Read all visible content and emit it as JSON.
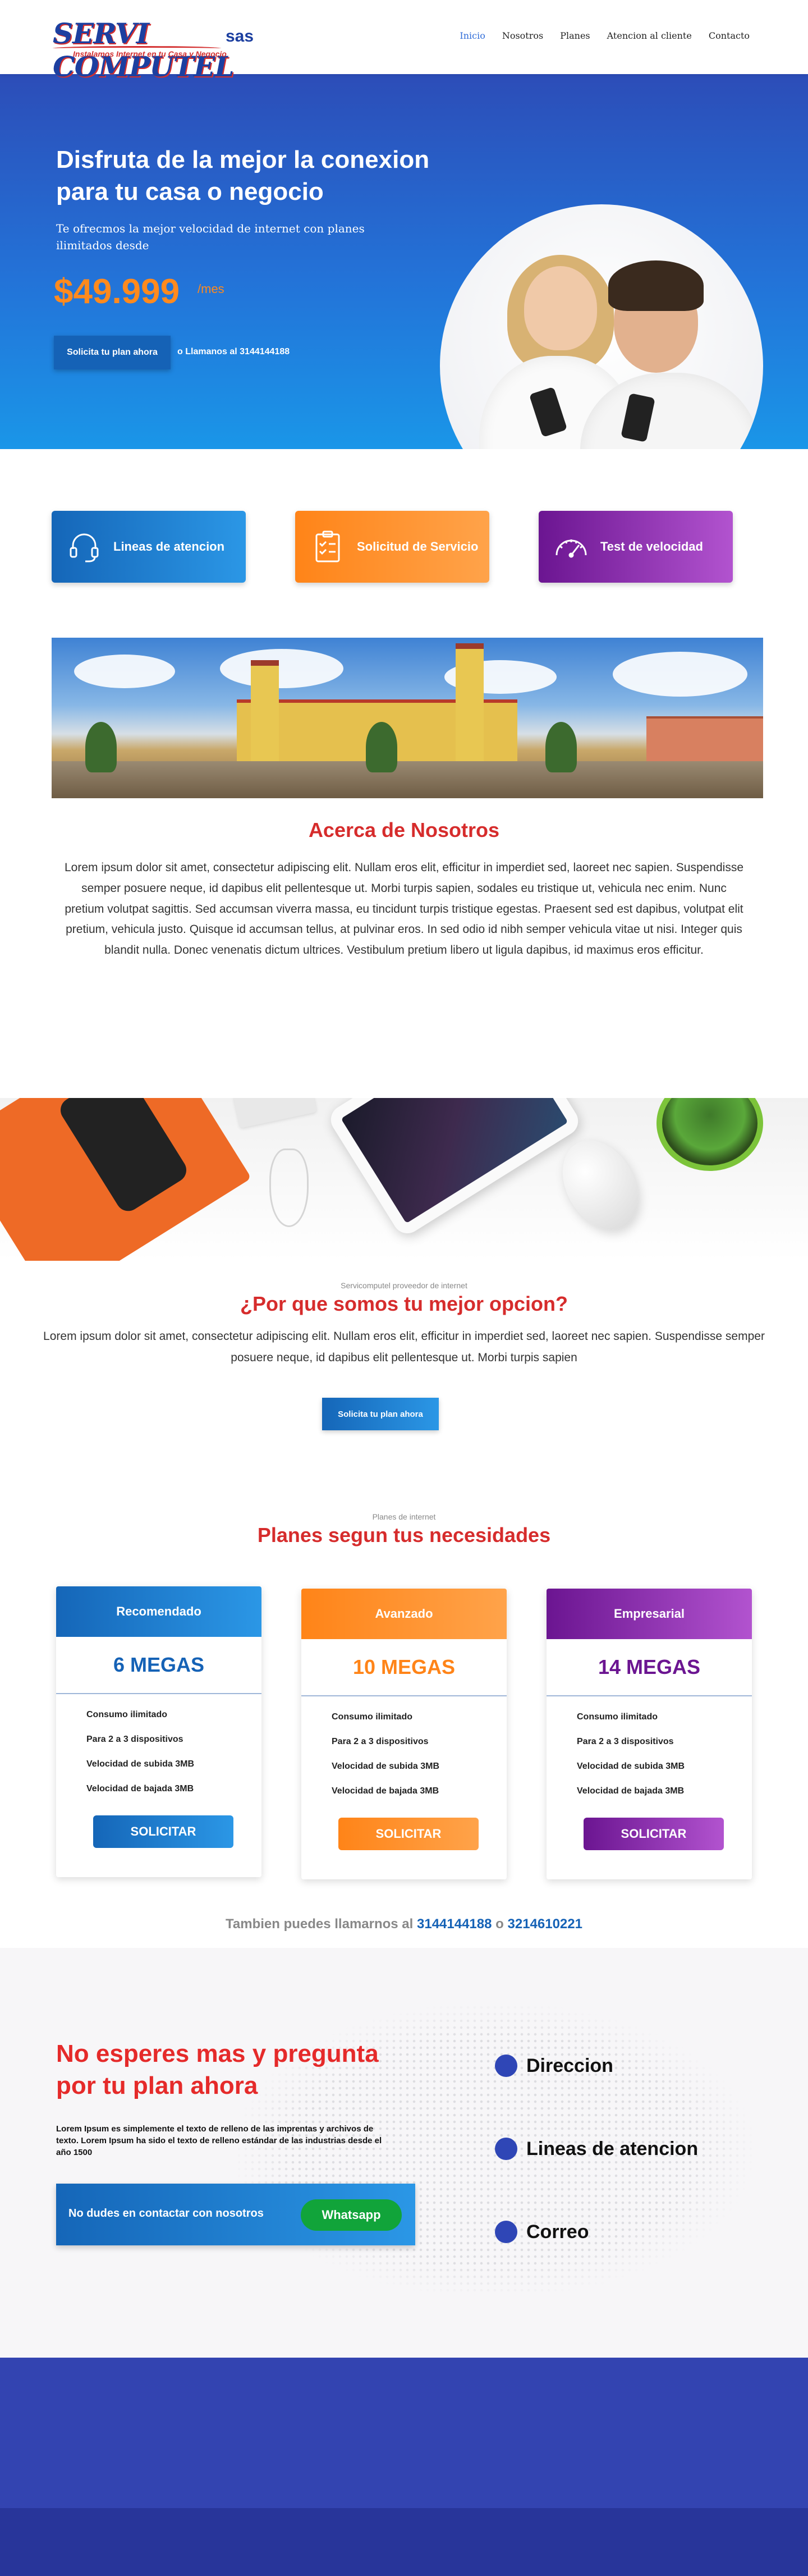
{
  "header": {
    "logo_main": "SERVI COMPUTEL",
    "logo_suffix": "sas",
    "logo_tagline": "Instalamos Internet en tu Casa y Negocio",
    "nav": [
      "Inicio",
      "Nosotros",
      "Planes",
      "Atencion al cliente",
      "Contacto"
    ],
    "active_nav": "Inicio"
  },
  "hero": {
    "title": "Disfruta de la mejor la conexion para tu casa o negocio",
    "subtitle": "Te ofrecmos la mejor velocidad de internet  con planes ilimitados desde",
    "price": "$49.999",
    "per": "/mes",
    "button": "Solicita tu plan ahora",
    "call": "o Llamanos al 3144144188"
  },
  "features": [
    {
      "label": "Lineas de atencion",
      "icon": "headset-icon"
    },
    {
      "label": "Solicitud de Servicio",
      "icon": "checklist-icon"
    },
    {
      "label": "Test de velocidad",
      "icon": "speedometer-icon"
    }
  ],
  "about": {
    "title": "Acerca de Nosotros",
    "text": "Lorem ipsum dolor sit amet, consectetur adipiscing elit. Nullam eros elit, efficitur in imperdiet sed, laoreet nec sapien. Suspendisse semper posuere neque, id dapibus elit pellentesque ut. Morbi turpis sapien, sodales eu tristique ut, vehicula nec enim. Nunc pretium volutpat sagittis. Sed accumsan viverra massa, eu tincidunt turpis tristique egestas. Praesent sed est dapibus, volutpat elit pretium, vehicula justo. Quisque id accumsan tellus, at pulvinar eros. In sed odio id nibh semper vehicula vitae ut nisi. Integer quis blandit nulla. Donec venenatis dictum ultrices. Vestibulum pretium libero ut ligula dapibus, id maximus eros efficitur."
  },
  "why": {
    "small": "Servicomputel proveedor de internet",
    "title": "¿Por que somos tu mejor opcion?",
    "text": "Lorem ipsum dolor sit amet, consectetur adipiscing elit. Nullam eros elit, efficitur in  imperdiet sed, laoreet nec sapien. Suspendisse semper posuere neque, id dapibus elit pellentesque ut. Morbi turpis sapien",
    "button": "Solicita tu plan ahora"
  },
  "plans": {
    "small": "Planes  de internet",
    "title": "Planes segun tus necesidades",
    "items": [
      {
        "name": "Recomendado",
        "speed": "6 MEGAS",
        "features": [
          "Consumo ilimitado",
          "Para 2 a 3 dispositivos",
          "Velocidad de subida 3MB",
          "Velocidad de bajada 3MB"
        ],
        "button": "SOLICITAR"
      },
      {
        "name": "Avanzado",
        "speed": "10 MEGAS",
        "features": [
          "Consumo ilimitado",
          "Para 2 a 3 dispositivos",
          "Velocidad de subida 3MB",
          "Velocidad de bajada 3MB"
        ],
        "button": "SOLICITAR"
      },
      {
        "name": "Empresarial",
        "speed": "14 MEGAS",
        "features": [
          "Consumo ilimitado",
          "Para 2 a 3 dispositivos",
          "Velocidad de subida 3MB",
          "Velocidad de bajada 3MB"
        ],
        "button": "SOLICITAR"
      }
    ]
  },
  "callus": {
    "prefix": "Tambien puedes llamarnos al",
    "phone1": "3144144188",
    "joiner": "o",
    "phone2": "3214610221"
  },
  "contact": {
    "title": "No esperes mas y pregunta por tu plan ahora",
    "text": "Lorem Ipsum es simplemente el texto de relleno de las imprentas y archivos de texto. Lorem Ipsum ha sido el texto de relleno estándar de las industrias desde el año 1500",
    "box_label": "No dudes en contactar con nosotros",
    "whatsapp": "Whatsapp",
    "items": [
      "Direccion",
      "Lineas de atencion",
      "Correo"
    ]
  },
  "colors": {
    "brand_blue": "#1562b6",
    "accent_orange": "#ff8418",
    "accent_purple": "#6b1591",
    "heading_red": "#d62c2c",
    "footer_blue": "#3344b1"
  }
}
